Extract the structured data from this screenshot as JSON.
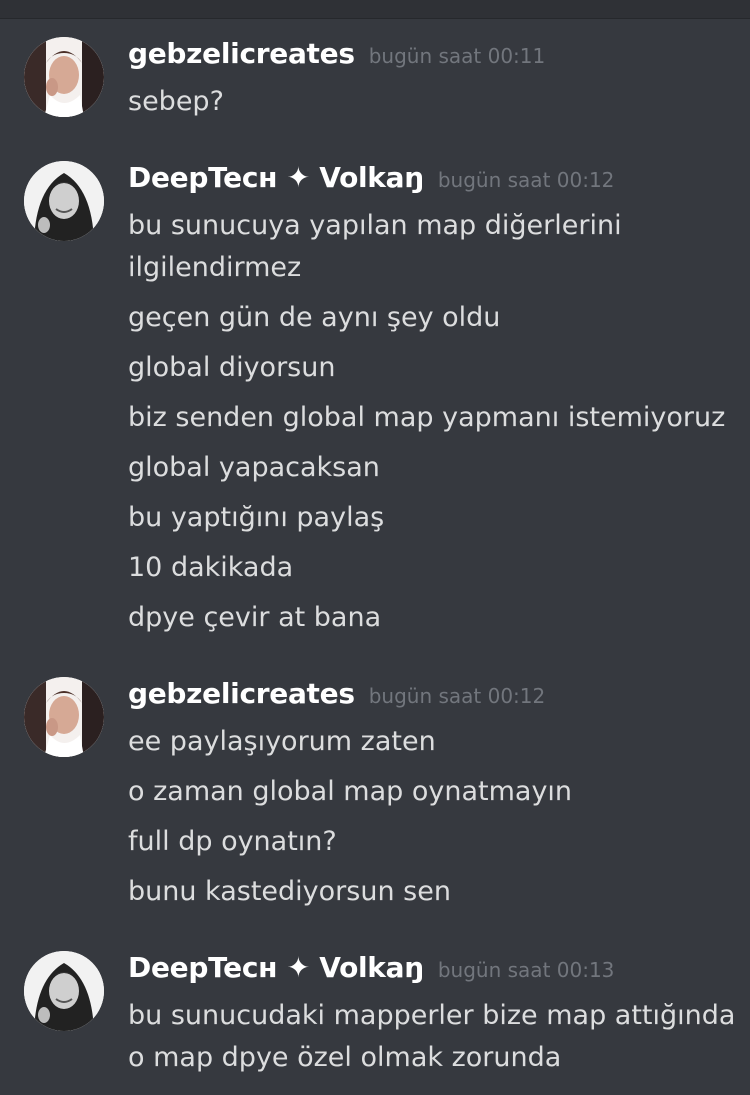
{
  "messages": [
    {
      "username": "gebzelicreates",
      "timestamp": "bugün saat 00:11",
      "lines": [
        "sebep?"
      ]
    },
    {
      "username": "DeepTecн ✦ Volkaŋ",
      "timestamp": "bugün saat 00:12",
      "lines": [
        "bu sunucuya yapılan map diğerlerini ilgilendirmez",
        "geçen gün de aynı şey oldu",
        "global diyorsun",
        "biz senden global map yapmanı istemiyoruz",
        "global yapacaksan",
        "bu yaptığını paylaş",
        "10 dakikada",
        "dpye çevir at bana"
      ]
    },
    {
      "username": "gebzelicreates",
      "timestamp": "bugün saat 00:12",
      "lines": [
        "ee paylaşıyorum zaten",
        "o zaman global map oynatmayın",
        "full dp oynatın?",
        "bunu kastediyorsun sen"
      ]
    },
    {
      "username": "DeepTecн ✦ Volkaŋ",
      "timestamp": "bugün saat 00:13",
      "lines": [
        "bu sunucudaki mapperler bize map attığında",
        "o map dpye özel olmak zorunda"
      ]
    }
  ]
}
